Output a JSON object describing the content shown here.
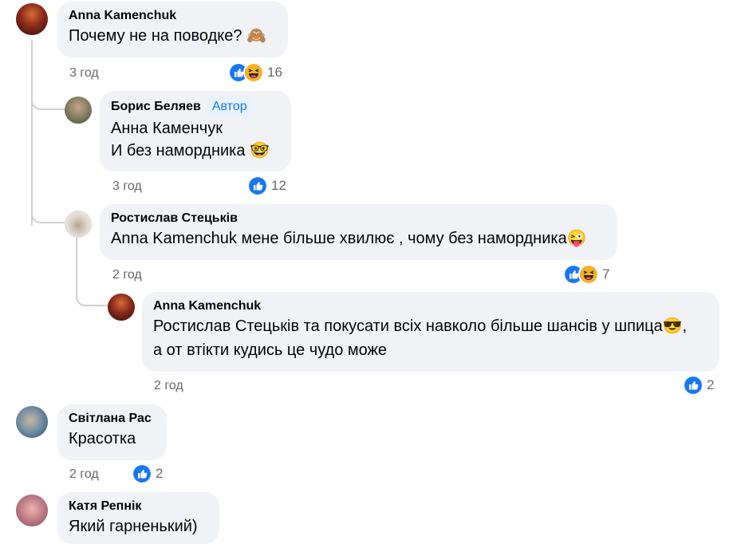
{
  "comments": [
    {
      "author": "Anna Kamenchuk",
      "lines": [
        "Почему не на поводке? 🙈"
      ],
      "time": "3 год",
      "reactions": [
        "like",
        "haha"
      ],
      "count": "16"
    },
    {
      "author": "Борис Беляев",
      "badge": "Автор",
      "lines": [
        "Анна Каменчук",
        "И без намордника 🤓"
      ],
      "time": "3 год",
      "reactions": [
        "like"
      ],
      "count": "12"
    },
    {
      "author": "Ростислав Стецьків",
      "lines": [
        "Anna Kamenchuk мене більше хвилює , чому без намордника😜"
      ],
      "time": "2 год",
      "reactions": [
        "like",
        "haha"
      ],
      "count": "7"
    },
    {
      "author": "Anna Kamenchuk",
      "lines": [
        "Ростислав Стецьків та покусати всіх навколо більше шансів у шпица😎,",
        "а от втікти кудись це чудо може"
      ],
      "time": "2 год",
      "reactions": [
        "like"
      ],
      "count": "2"
    },
    {
      "author": "Світлана Рас",
      "lines": [
        "Красотка"
      ],
      "time": "2 год",
      "reactions": [
        "like"
      ],
      "count": "2"
    },
    {
      "author": "Катя Репнік",
      "lines": [
        "Який гарненький)"
      ]
    }
  ],
  "colors": {
    "bubble": "#f0f2f5",
    "like": "#1877f2",
    "haha": "#f7b125",
    "meta": "#65676b",
    "thread_line": "#ced0d4"
  },
  "icons": [
    "like-icon",
    "haha-icon",
    "monkey-emoji",
    "nerd-emoji",
    "winking-tongue-emoji",
    "sunglasses-emoji"
  ]
}
